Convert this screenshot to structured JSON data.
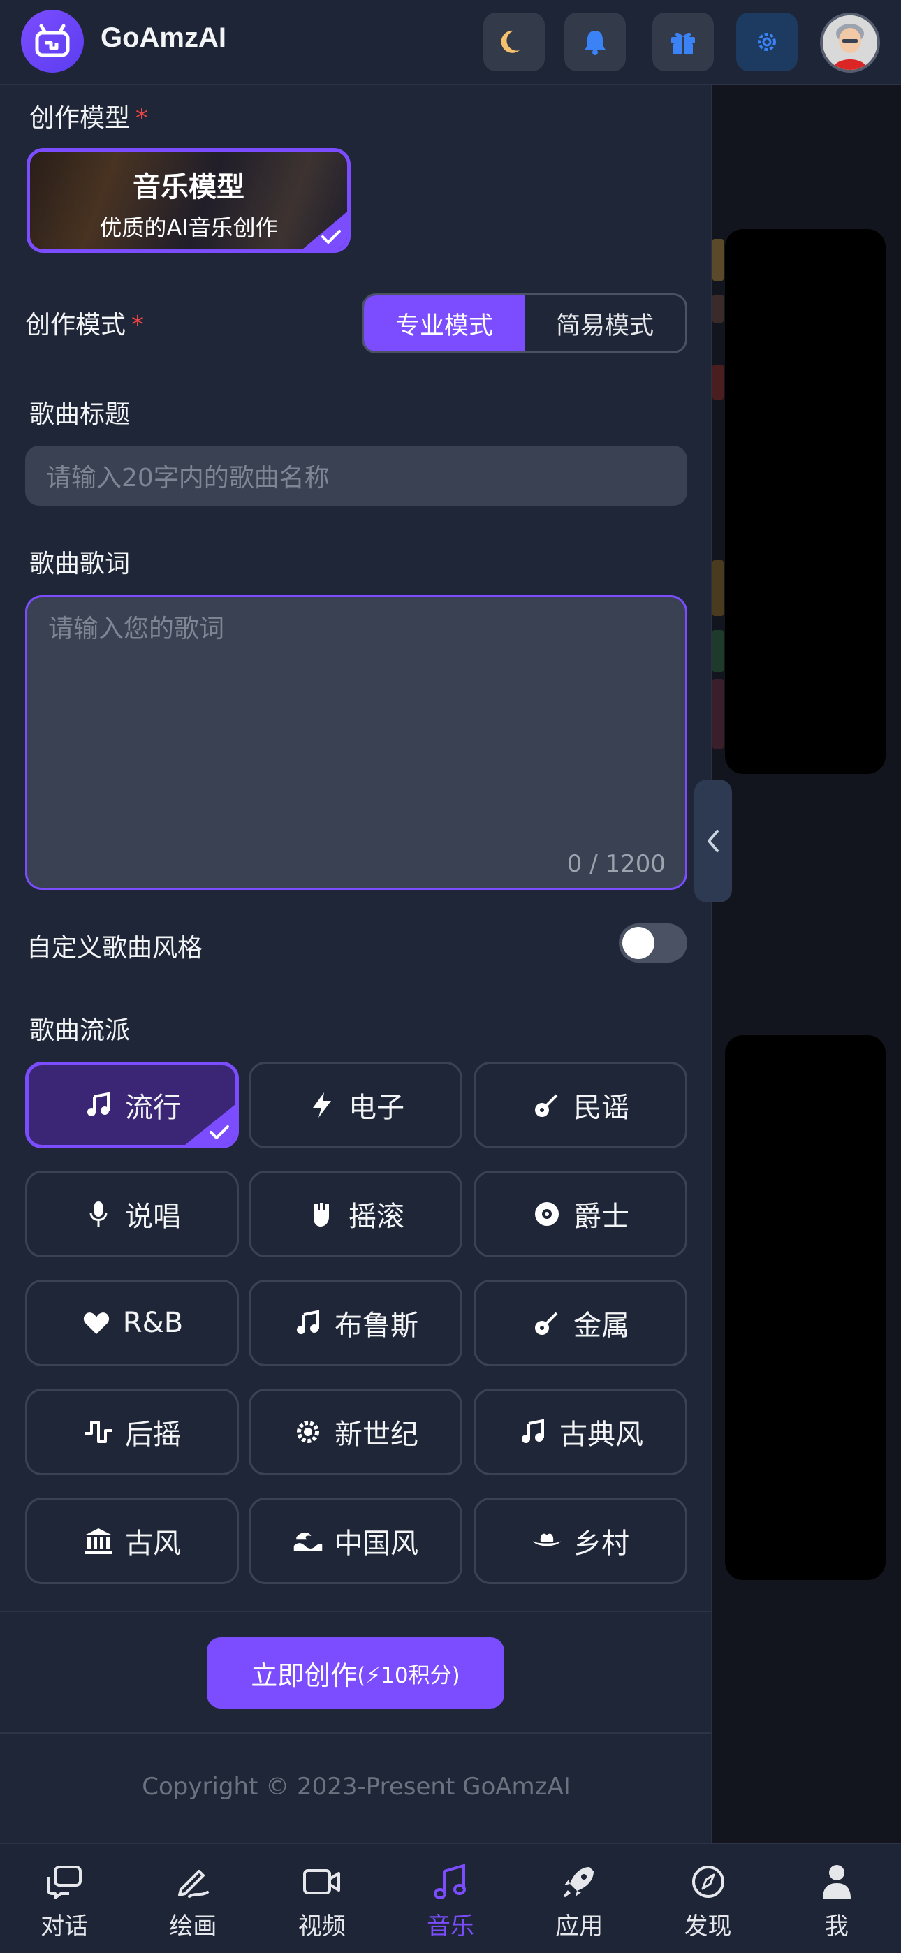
{
  "header": {
    "brand": "GoAmzAI",
    "icons": [
      "moon-icon",
      "bell-icon",
      "gift-icon",
      "gear-icon",
      "avatar"
    ]
  },
  "form": {
    "model_label": "创作模型",
    "required_mark": "*",
    "model_card": {
      "title": "音乐模型",
      "subtitle": "优质的AI音乐创作",
      "selected": true
    },
    "mode_label": "创作模式",
    "modes": [
      {
        "label": "专业模式",
        "selected": true
      },
      {
        "label": "简易模式",
        "selected": false
      }
    ],
    "title_label": "歌曲标题",
    "title_placeholder": "请输入20字内的歌曲名称",
    "lyrics_label": "歌曲歌词",
    "lyrics_placeholder": "请输入您的歌词",
    "lyrics_count": "0 / 1200",
    "custom_style_label": "自定义歌曲风格",
    "custom_style_on": false,
    "genre_label": "歌曲流派",
    "genres": [
      {
        "label": "流行",
        "icon": "music-note-icon",
        "selected": true
      },
      {
        "label": "电子",
        "icon": "bolt-icon",
        "selected": false
      },
      {
        "label": "民谣",
        "icon": "guitar-icon",
        "selected": false
      },
      {
        "label": "说唱",
        "icon": "microphone-icon",
        "selected": false
      },
      {
        "label": "摇滚",
        "icon": "rock-hand-icon",
        "selected": false
      },
      {
        "label": "爵士",
        "icon": "record-icon",
        "selected": false
      },
      {
        "label": "R&B",
        "icon": "heart-icon",
        "selected": false
      },
      {
        "label": "布鲁斯",
        "icon": "music-note-icon",
        "selected": false
      },
      {
        "label": "金属",
        "icon": "guitar-icon",
        "selected": false
      },
      {
        "label": "后摇",
        "icon": "wave-icon",
        "selected": false
      },
      {
        "label": "新世纪",
        "icon": "sun-gear-icon",
        "selected": false
      },
      {
        "label": "古典风",
        "icon": "music-note-icon",
        "selected": false
      },
      {
        "label": "古风",
        "icon": "temple-icon",
        "selected": false
      },
      {
        "label": "中国风",
        "icon": "water-icon",
        "selected": false
      },
      {
        "label": "乡村",
        "icon": "cowboy-hat-icon",
        "selected": false
      }
    ],
    "create_button": "立即创作",
    "create_cost": "(⚡10积分)"
  },
  "footer": {
    "copyright": "Copyright © 2023-Present GoAmzAI"
  },
  "bottom_nav": [
    {
      "label": "对话",
      "icon": "chat-icon",
      "active": false
    },
    {
      "label": "绘画",
      "icon": "pen-icon",
      "active": false
    },
    {
      "label": "视频",
      "icon": "video-icon",
      "active": false
    },
    {
      "label": "音乐",
      "icon": "music-icon",
      "active": true
    },
    {
      "label": "应用",
      "icon": "rocket-icon",
      "active": false
    },
    {
      "label": "发现",
      "icon": "compass-icon",
      "active": false
    },
    {
      "label": "我",
      "icon": "user-icon",
      "active": false
    }
  ],
  "colors": {
    "accent": "#7c4dff",
    "background": "#1f2637",
    "required": "#ef4444"
  }
}
